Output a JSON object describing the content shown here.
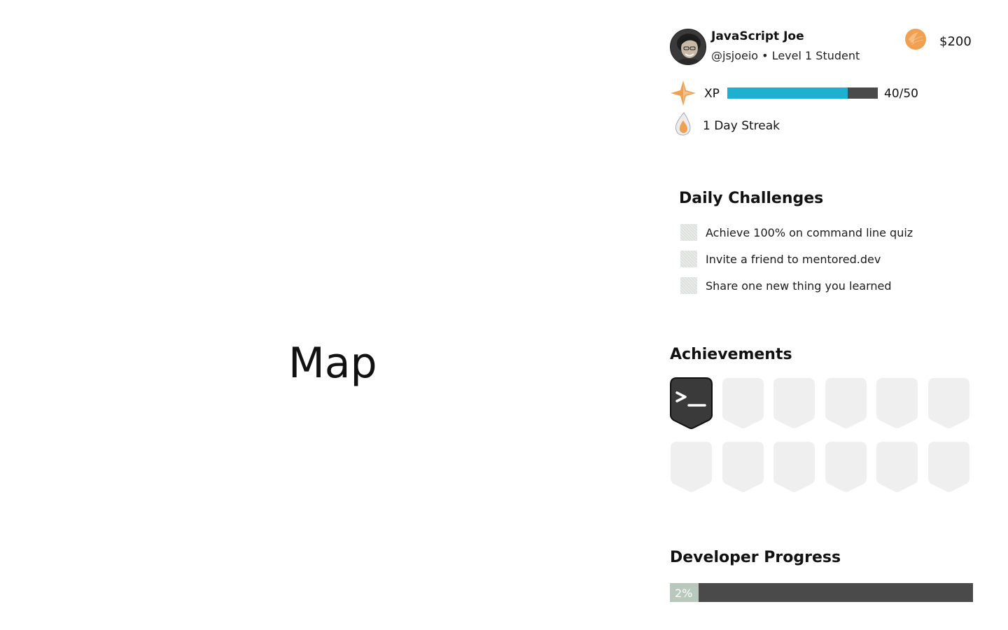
{
  "map": {
    "title": "Map"
  },
  "profile": {
    "name": "JavaScript Joe",
    "handle": "@jsjoeio • Level 1 Student",
    "coins": "$200"
  },
  "xp": {
    "label": "XP",
    "current": 40,
    "max": 50,
    "display": "40/50",
    "fill_color": "#1eb0cf",
    "track_color": "#4a4a4a"
  },
  "streak": {
    "label": "1 Day Streak"
  },
  "daily_challenges": {
    "title": "Daily Challenges",
    "items": [
      {
        "label": "Achieve 100% on command line quiz",
        "done": false
      },
      {
        "label": "Invite a friend to mentored.dev",
        "done": false
      },
      {
        "label": "Share one new thing you learned",
        "done": false
      }
    ]
  },
  "achievements": {
    "title": "Achievements",
    "badges": [
      {
        "unlocked": true,
        "icon": "terminal-icon"
      },
      {
        "unlocked": false
      },
      {
        "unlocked": false
      },
      {
        "unlocked": false
      },
      {
        "unlocked": false
      },
      {
        "unlocked": false
      },
      {
        "unlocked": false
      },
      {
        "unlocked": false
      },
      {
        "unlocked": false
      },
      {
        "unlocked": false
      },
      {
        "unlocked": false
      },
      {
        "unlocked": false
      }
    ]
  },
  "developer_progress": {
    "title": "Developer Progress",
    "percent": 2,
    "display": "2%",
    "fill_color": "#b8c8bc",
    "track_color": "#4a4a4a"
  },
  "colors": {
    "accent_orange": "#f0a050",
    "badge_locked": "#efefef",
    "badge_unlocked": "#3a3a3a"
  }
}
